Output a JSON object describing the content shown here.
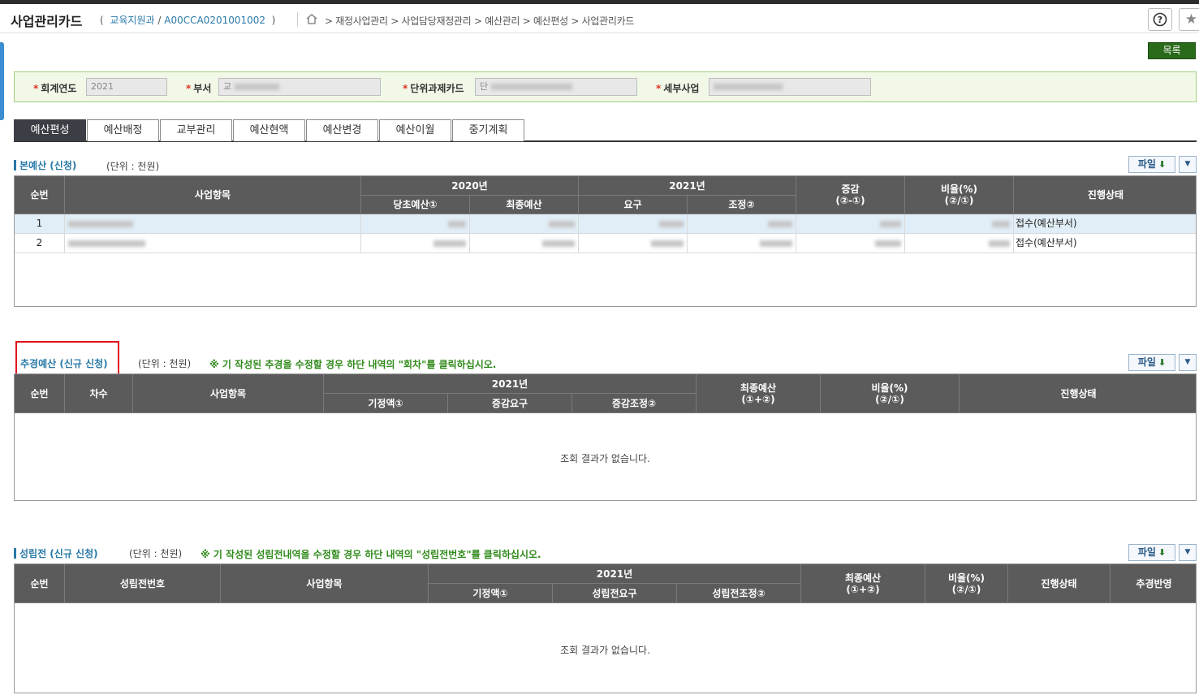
{
  "header": {
    "title": "사업관리카드",
    "paren_open": "(",
    "dept": "교육지원과",
    "slash": "/",
    "code": "A00CCA0201001002",
    "paren_close": ")",
    "breadcrumb": ">  재정사업관리 > 사업담당재정관리 > 예산관리 > 예산편성 > 사업관리카드",
    "help_icon": "question-icon",
    "star_icon": "star-icon"
  },
  "toolbar": {
    "list_label": "목록"
  },
  "filter": {
    "req_mark": "*",
    "fiscal_year_label": "회계연도",
    "fiscal_year_value": "2021",
    "dept_label": "부서",
    "dept_value": "교",
    "unit_card_label": "단위과제카드",
    "unit_card_value": "단",
    "detail_label": "세부사업",
    "detail_value": ""
  },
  "tabs": [
    "예산편성",
    "예산배정",
    "교부관리",
    "예산현액",
    "예산변경",
    "예산이월",
    "중기계획"
  ],
  "main_budget": {
    "title": "본예산 (신청)",
    "unit": "(단위 : 천원)",
    "file_label": "파일",
    "headers": {
      "seq": "순번",
      "item": "사업항목",
      "y2020": "2020년",
      "initial": "당초예산①",
      "final": "최종예산",
      "y2021": "2021년",
      "request": "요구",
      "adjust": "조정②",
      "change": "증감\n(②-①)",
      "ratio": "비율(%)\n(②/①)",
      "status": "진행상태"
    },
    "rows": [
      {
        "seq": "1",
        "status": "접수(예산부서)"
      },
      {
        "seq": "2",
        "status": "접수(예산부서)"
      }
    ]
  },
  "supp_budget": {
    "title": "추경예산 (신규 신청)",
    "unit": "(단위 : 천원)",
    "note": "※ 기 작성된 추경을 수정할 경우 하단 내역의 \"회차\"를 클릭하십시오.",
    "file_label": "파일",
    "headers": {
      "seq": "순번",
      "round": "차수",
      "item": "사업항목",
      "y2021": "2021년",
      "set": "기정액①",
      "inc_req": "증감요구",
      "inc_adj": "증감조정②",
      "final": "최종예산\n(①+②)",
      "ratio": "비율(%)\n(②/①)",
      "status": "진행상태"
    },
    "empty": "조회 결과가 없습니다."
  },
  "pre_budget": {
    "title": "성립전 (신규 신청)",
    "unit": "(단위 : 천원)",
    "note": "※ 기 작성된 성립전내역을 수정할 경우 하단 내역의 \"성립전번호\"를 클릭하십시오.",
    "file_label": "파일",
    "headers": {
      "seq": "순번",
      "number": "성립전번호",
      "item": "사업항목",
      "y2021": "2021년",
      "set": "기정액①",
      "req": "성립전요구",
      "adj": "성립전조정②",
      "final": "최종예산\n(①+②)",
      "ratio": "비율(%)\n(②/①)",
      "status": "진행상태",
      "reflect": "추경반영"
    },
    "empty": "조회 결과가 없습니다."
  },
  "colors": {
    "accent": "#2a7aa8",
    "header_bg": "#5b5b5b",
    "tab_active": "#3b3f45",
    "green_btn": "#2a6a1b",
    "note_green": "#2f8a1a",
    "highlight": "#e0141e"
  }
}
